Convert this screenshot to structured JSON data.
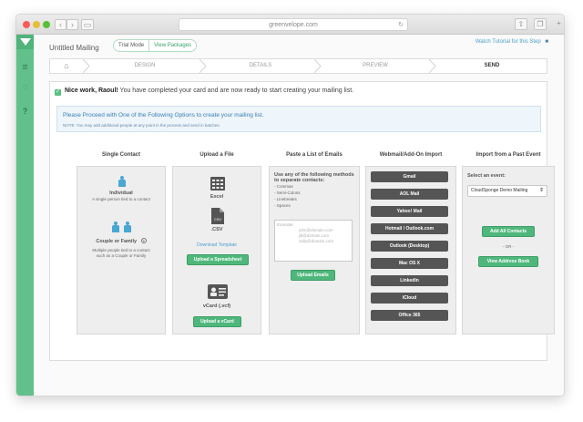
{
  "browser": {
    "url": "greenvelope.com",
    "reload_icon": "reload-icon",
    "back_label": "‹",
    "forward_label": "›",
    "sidebar_toggle_label": "▭",
    "share_label": "⇧",
    "tabs_label": "❐",
    "new_tab_label": "+",
    "colors": {
      "close": "#fc5b57",
      "minimize": "#e5bf3c",
      "zoom": "#57c038"
    }
  },
  "sidebar": {
    "brand_color": "#62c18a",
    "icons": [
      {
        "name": "menu-icon",
        "glyph": "≡"
      },
      {
        "name": "chat-icon",
        "glyph": "◌"
      },
      {
        "name": "help-icon",
        "glyph": "?"
      }
    ]
  },
  "header": {
    "title": "Untitled Mailing",
    "trial_mode": "Trial Mode",
    "view_packages": "View Packages",
    "tutorial_link": "Watch Tutorial for this Step",
    "tutorial_icon": "video-icon",
    "tutorial_glyph": "■"
  },
  "steps": {
    "home_icon": "home-icon",
    "home_glyph": "⌂",
    "items": [
      "DESIGN",
      "DETAILS",
      "PREVIEW",
      "SEND"
    ],
    "active": "SEND"
  },
  "success": {
    "check_glyph": "✓",
    "bold": "Nice work, Raoul!",
    "rest": " You have completed your card and are now ready to start creating your mailing list."
  },
  "info": {
    "line1": "Please Proceed with One of the Following Options to create your mailing list.",
    "line2": "NOTE: You may add additional people at any point in the process and send in batches."
  },
  "columns": {
    "single": {
      "heading": "Single Contact",
      "individual_title": "Individual",
      "individual_desc": "A single person tied to a contact",
      "couple_title": "Couple or Family",
      "couple_help_glyph": "?",
      "couple_desc_1": "Multiple people tied to a contact",
      "couple_desc_2": "such as a Couple or Family"
    },
    "upload": {
      "heading": "Upload a File",
      "excel": "Excel",
      "csv": ".CSV",
      "csv_badge": "CSV",
      "download_template": "Download Template",
      "upload_spreadsheet": "Upload a Spreadsheet",
      "vcard": "vCard (.vcf)",
      "upload_vcard": "Upload a vCard"
    },
    "paste": {
      "heading": "Paste a List of Emails",
      "instructions_1": "Use any of the following methods",
      "instructions_2": "to separate contacts:",
      "methods": [
        "- Commas",
        "- Semi-Colons",
        "- Linebreaks",
        "- Spaces"
      ],
      "placeholder_label": "Example:",
      "placeholder_emails": [
        "john@domain.com",
        "jill@domain.com",
        "sally@domain.com"
      ],
      "upload_emails": "Upload Emails"
    },
    "webmail": {
      "heading": "Webmail/Add-On Import",
      "providers": [
        "Gmail",
        "AOL Mail",
        "Yahoo! Mail",
        "Hotmail / Outlook.com",
        "Outlook (Desktop)",
        "Mac OS X",
        "LinkedIn",
        "iCloud",
        "Office 365"
      ]
    },
    "past": {
      "heading": "Import from a Past Event",
      "select_label": "Select an event:",
      "selected_event": "CloudSponge Demo Mailing",
      "select_arrow": "⇕",
      "add_all": "Add All Contacts",
      "or": "- OR -",
      "view_address_book": "View Address Book"
    }
  }
}
